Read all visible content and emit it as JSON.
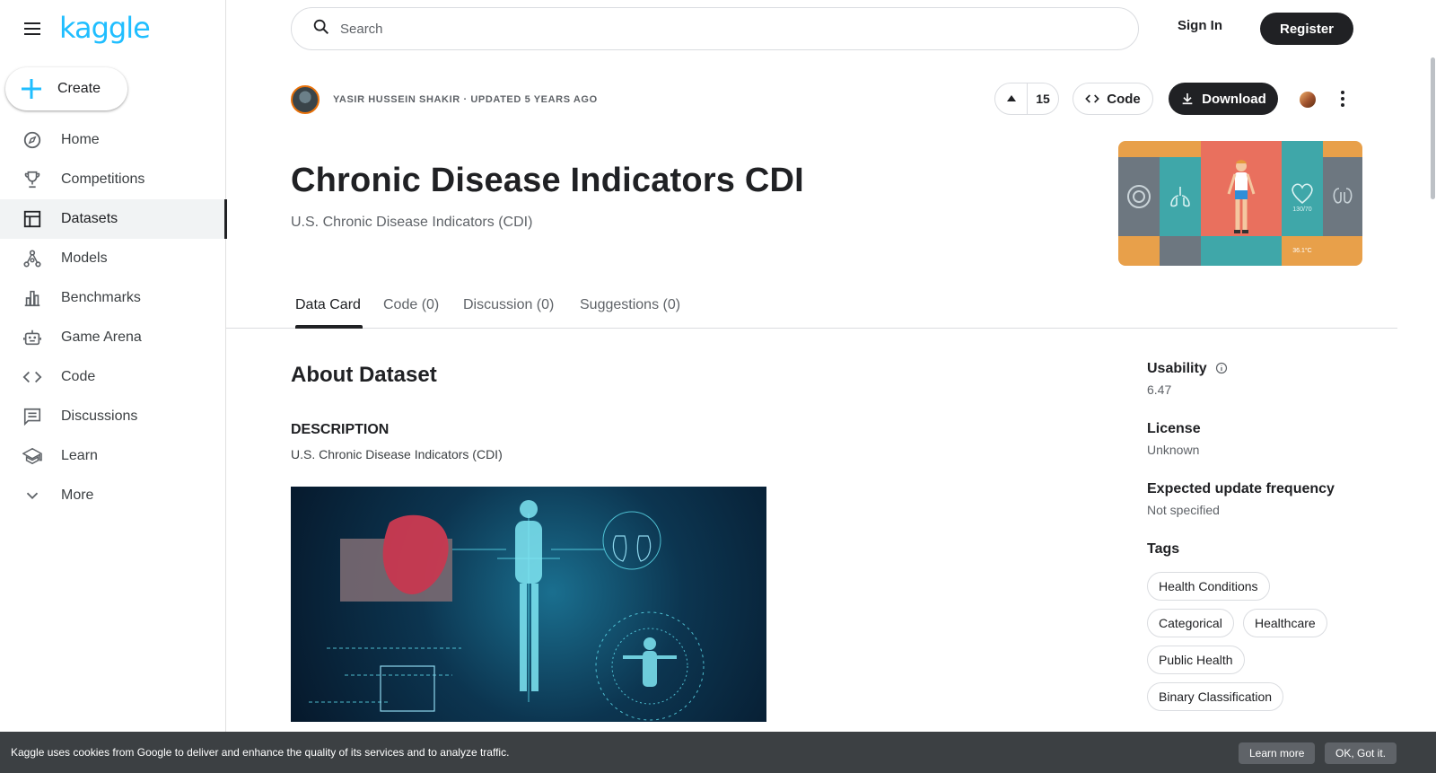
{
  "app": {
    "logo": "kaggle"
  },
  "sidebar": {
    "create_label": "Create",
    "items": [
      {
        "label": "Home",
        "icon": "compass-icon"
      },
      {
        "label": "Competitions",
        "icon": "trophy-icon"
      },
      {
        "label": "Datasets",
        "icon": "table-icon",
        "active": true
      },
      {
        "label": "Models",
        "icon": "models-icon"
      },
      {
        "label": "Benchmarks",
        "icon": "bar-chart-icon"
      },
      {
        "label": "Game Arena",
        "icon": "robot-icon"
      },
      {
        "label": "Code",
        "icon": "code-icon"
      },
      {
        "label": "Discussions",
        "icon": "comment-icon"
      },
      {
        "label": "Learn",
        "icon": "school-icon"
      },
      {
        "label": "More",
        "icon": "chevron-down-icon"
      }
    ]
  },
  "header": {
    "search_placeholder": "Search",
    "sign_in": "Sign In",
    "register": "Register"
  },
  "dataset": {
    "author_line": "YASIR HUSSEIN SHAKIR · UPDATED 5 YEARS AGO",
    "votes": "15",
    "code_label": "Code",
    "download_label": "Download",
    "title": "Chronic Disease Indicators CDI",
    "subtitle": "U.S. Chronic Disease Indicators (CDI)"
  },
  "tabs": [
    "Data Card",
    "Code (0)",
    "Discussion (0)",
    "Suggestions (0)"
  ],
  "about": {
    "heading": "About Dataset",
    "desc_heading": "DESCRIPTION",
    "desc_text": "U.S. Chronic Disease Indicators (CDI)"
  },
  "meta": {
    "usability_label": "Usability",
    "usability_value": "6.47",
    "license_label": "License",
    "license_value": "Unknown",
    "freq_label": "Expected update frequency",
    "freq_value": "Not specified",
    "tags_label": "Tags",
    "tags": [
      "Health Conditions",
      "Categorical",
      "Healthcare",
      "Public Health",
      "Binary Classification"
    ]
  },
  "cookie": {
    "message": "Kaggle uses cookies from Google to deliver and enhance the quality of its services and to analyze traffic.",
    "learn_more": "Learn more",
    "ok": "OK, Got it."
  },
  "colors": {
    "brand": "#20beff",
    "dark": "#202124",
    "cookie_bg": "#3c4043",
    "medal": "#a0522d"
  }
}
